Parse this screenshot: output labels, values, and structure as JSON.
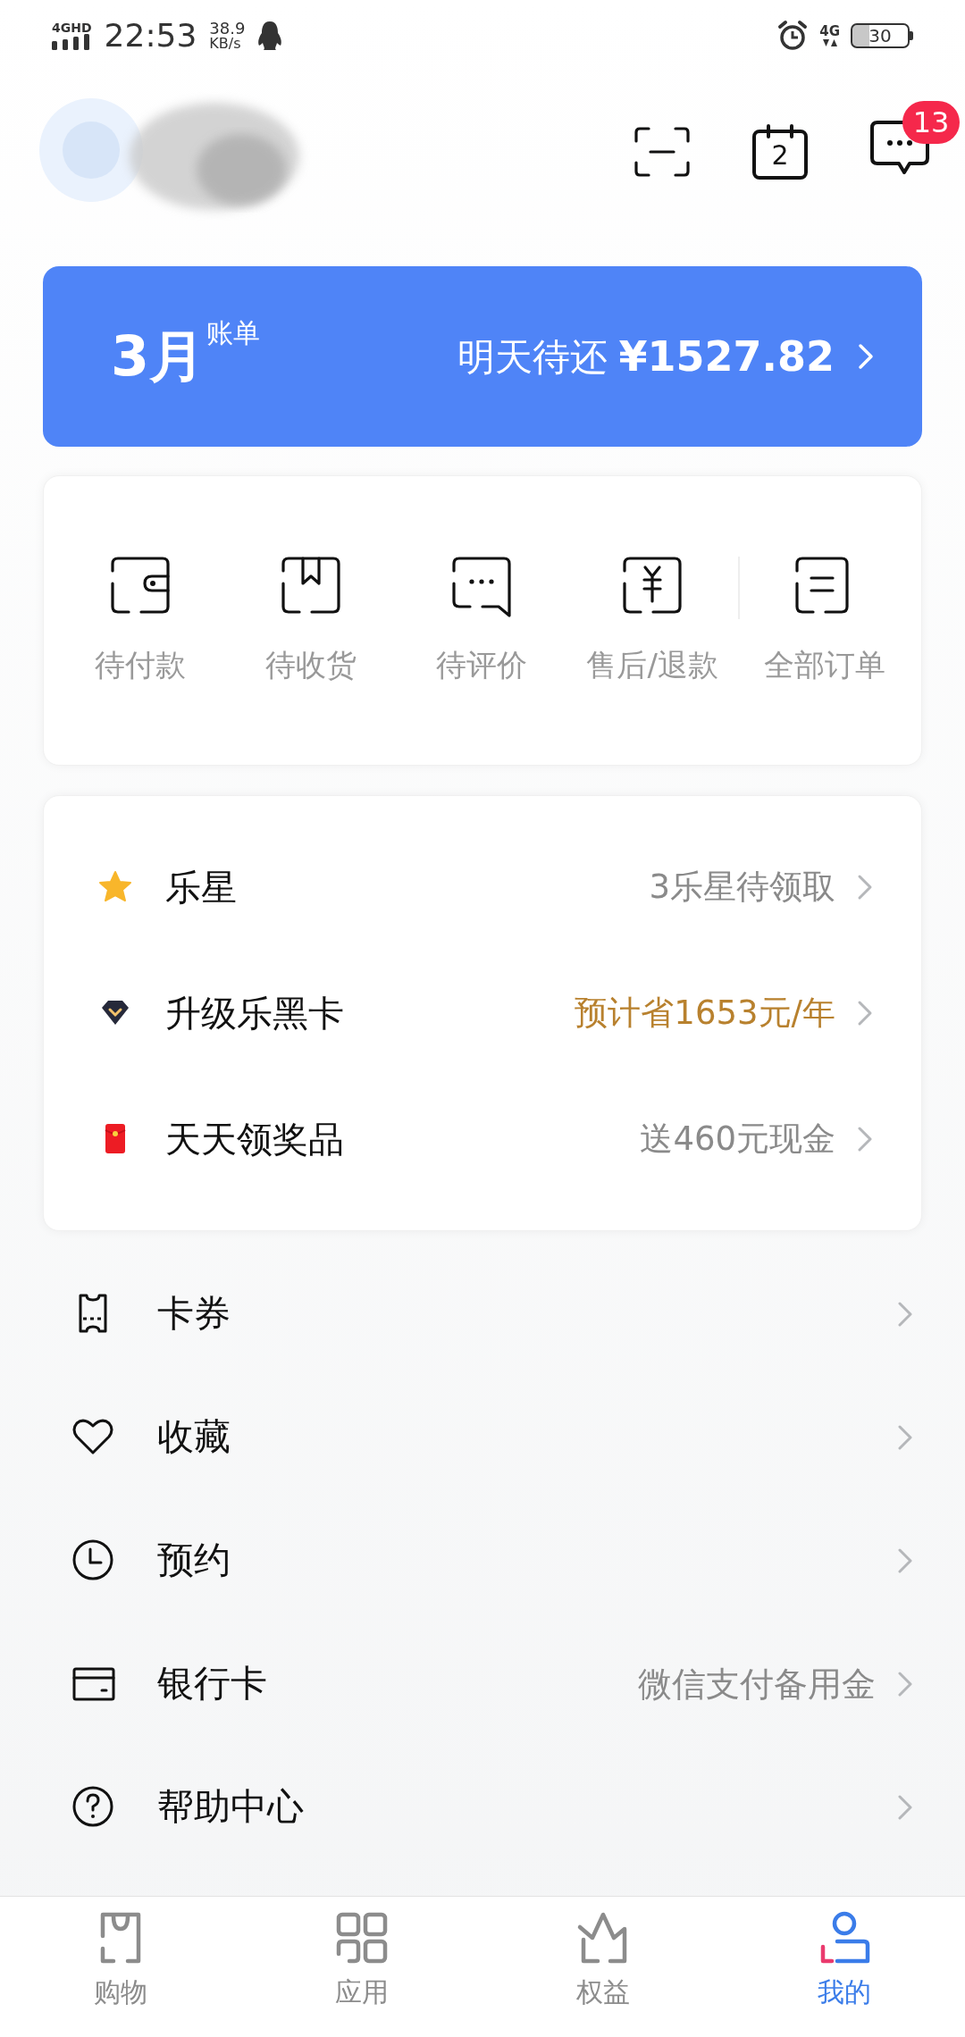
{
  "status_bar": {
    "network": "4GHD",
    "time": "22:53",
    "speed": "38.9",
    "speed_unit": "KB/s",
    "network_right": "4G",
    "battery": "30"
  },
  "header": {
    "calendar_day": "2",
    "message_badge": "13"
  },
  "bill": {
    "month": "3月",
    "label": "账单",
    "due_label": "明天待还",
    "amount": "¥1527.82"
  },
  "orders": [
    {
      "label": "待付款",
      "kind": "wallet"
    },
    {
      "label": "待收货",
      "kind": "box"
    },
    {
      "label": "待评价",
      "kind": "comment"
    },
    {
      "label": "售后/退款",
      "kind": "refund"
    },
    {
      "label": "全部订单",
      "kind": "list"
    }
  ],
  "perks": [
    {
      "label": "乐星",
      "value": "3乐星待领取",
      "kind": "star",
      "highlighted": false
    },
    {
      "label": "升级乐黑卡",
      "value": "预计省1653元/年",
      "kind": "diamond",
      "highlighted": true
    },
    {
      "label": "天天领奖品",
      "value": "送460元现金",
      "kind": "redpacket",
      "highlighted": false
    }
  ],
  "menu": [
    {
      "label": "卡券",
      "kind": "ticket"
    },
    {
      "label": "收藏",
      "kind": "heart"
    },
    {
      "label": "预约",
      "kind": "clock"
    },
    {
      "label": "银行卡",
      "kind": "card",
      "value": "微信支付备用金"
    },
    {
      "label": "帮助中心",
      "kind": "help"
    }
  ],
  "nav": [
    {
      "label": "购物",
      "kind": "bag",
      "selected": false
    },
    {
      "label": "应用",
      "kind": "apps",
      "selected": false
    },
    {
      "label": "权益",
      "kind": "crown",
      "selected": false
    },
    {
      "label": "我的",
      "kind": "user",
      "selected": true
    }
  ]
}
